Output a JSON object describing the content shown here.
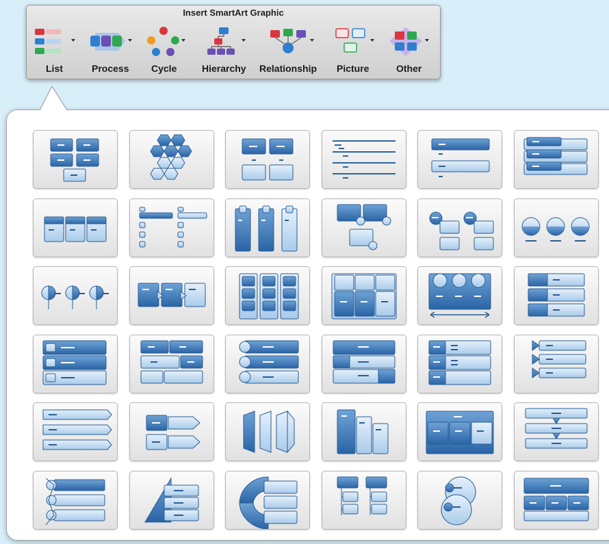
{
  "toolbar": {
    "title": "Insert SmartArt Graphic",
    "categories": [
      {
        "label": "List",
        "icon": "list-icon"
      },
      {
        "label": "Process",
        "icon": "process-icon"
      },
      {
        "label": "Cycle",
        "icon": "cycle-icon"
      },
      {
        "label": "Hierarchy",
        "icon": "hierarchy-icon"
      },
      {
        "label": "Relationship",
        "icon": "relationship-icon"
      },
      {
        "label": "Picture",
        "icon": "picture-icon"
      },
      {
        "label": "Other",
        "icon": "other-icon"
      }
    ]
  },
  "colors": {
    "tile_blue": "#3a78b8",
    "tile_light": "#b9d6ef",
    "icon_red": "#d9363e",
    "icon_green": "#2fa84f",
    "icon_blue": "#2f7fd1",
    "icon_purple": "#6b4fb5",
    "icon_orange": "#f39a1e"
  },
  "gallery": {
    "layout_count": 36,
    "columns": 6,
    "rows": 6
  }
}
